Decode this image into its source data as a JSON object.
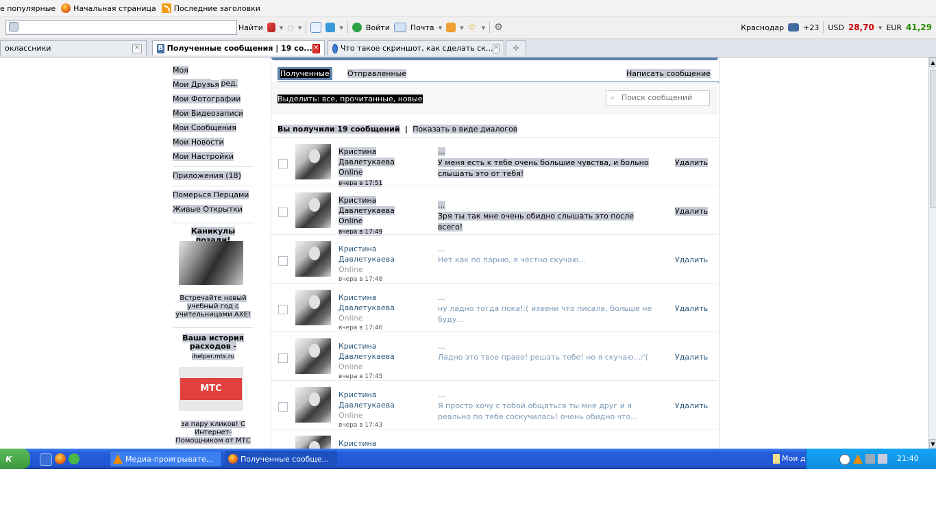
{
  "bookmarks": {
    "items": [
      "е популярные",
      "Начальная страница",
      "Последние заголовки"
    ]
  },
  "toolbar": {
    "find_label": "Найти",
    "login_label": "Войти",
    "mail_label": "Почта",
    "city": "Краснодар",
    "temperature": "+23",
    "usd_label": "USD",
    "usd_value": "28,70",
    "eur_label": "EUR",
    "eur_value": "41,29"
  },
  "tabs": [
    {
      "label": "оклассники"
    },
    {
      "label": "Полученные сообщения | 19 со..."
    },
    {
      "label": "Что такое скриншот, как сделать ск..."
    }
  ],
  "sidebar": {
    "items": [
      "Моя Страница",
      "Мои Друзья",
      "Мои Фотографии",
      "Мои Видеозаписи",
      "Мои Сообщения",
      "Мои Новости",
      "Мои Настройки"
    ],
    "edit_label": "ред.",
    "apps_label": "Приложения (18)",
    "apps": [
      "Померься Перцами",
      "Живые Открытки"
    ],
    "ad1_title": "Каникулы позади!",
    "ad1_text": "Встречайте новый учебный год с учительницами AXE!",
    "ad2_title": "Ваша история расходов -",
    "ad2_link": "ihelper.mts.ru",
    "ad2_logo": "МТС",
    "ad2_text": "за пару кликов! С Интернет-Помощником от МТС"
  },
  "messages_page": {
    "tab_received": "Полученные",
    "tab_sent": "Отправленные",
    "write_label": "Написать сообщение",
    "select_label": "Выделить:  все, прочитанные, новые",
    "search_placeholder": "Поиск сообщений",
    "count_text": "Вы получили 19 сообщений",
    "dialogs_link": "Показать в виде диалогов",
    "delete_label": "Удалить"
  },
  "messages": [
    {
      "name": "Кристина Давлетукаева",
      "status": "Online",
      "time": "вчера в 17:51",
      "preview": "...",
      "text": "У меня есть к тебе очень большие чувства, и больно слышать это от тебя!"
    },
    {
      "name": "Кристина Давлетукаева",
      "status": "Online",
      "time": "вчера в 17:49",
      "preview": "...",
      "text": "Зря ты так мне очень обидно слышать это после всего!"
    },
    {
      "name": "Кристина Давлетукаева",
      "status": "Online",
      "time": "вчера в 17:48",
      "preview": "...",
      "text": "Нет как по парню, я честно скучаю..."
    },
    {
      "name": "Кристина Давлетукаева",
      "status": "Online",
      "time": "вчера в 17:46",
      "preview": "...",
      "text": "ну ладно тогда пока!:( извени что писала, больше не буду..."
    },
    {
      "name": "Кристина Давлетукаева",
      "status": "Online",
      "time": "вчера в 17:45",
      "preview": "...",
      "text": "Ладно это твое право! решать тебе! но я скучаю...:'("
    },
    {
      "name": "Кристина Давлетукаева",
      "status": "Online",
      "time": "вчера в 17:43",
      "preview": "...",
      "text": "Я просто хочу с тобой общаться ты мне друг и я реально по тебе соскучилась! очень обидно что..."
    },
    {
      "name": "Кристина Давлетукаева"
    }
  ],
  "taskbar": {
    "start_label": "к",
    "tasks": [
      "Медиа-проигрывате...",
      "Полученные сообще..."
    ],
    "docs_label": "Мои докумен",
    "clock": "21:40"
  }
}
